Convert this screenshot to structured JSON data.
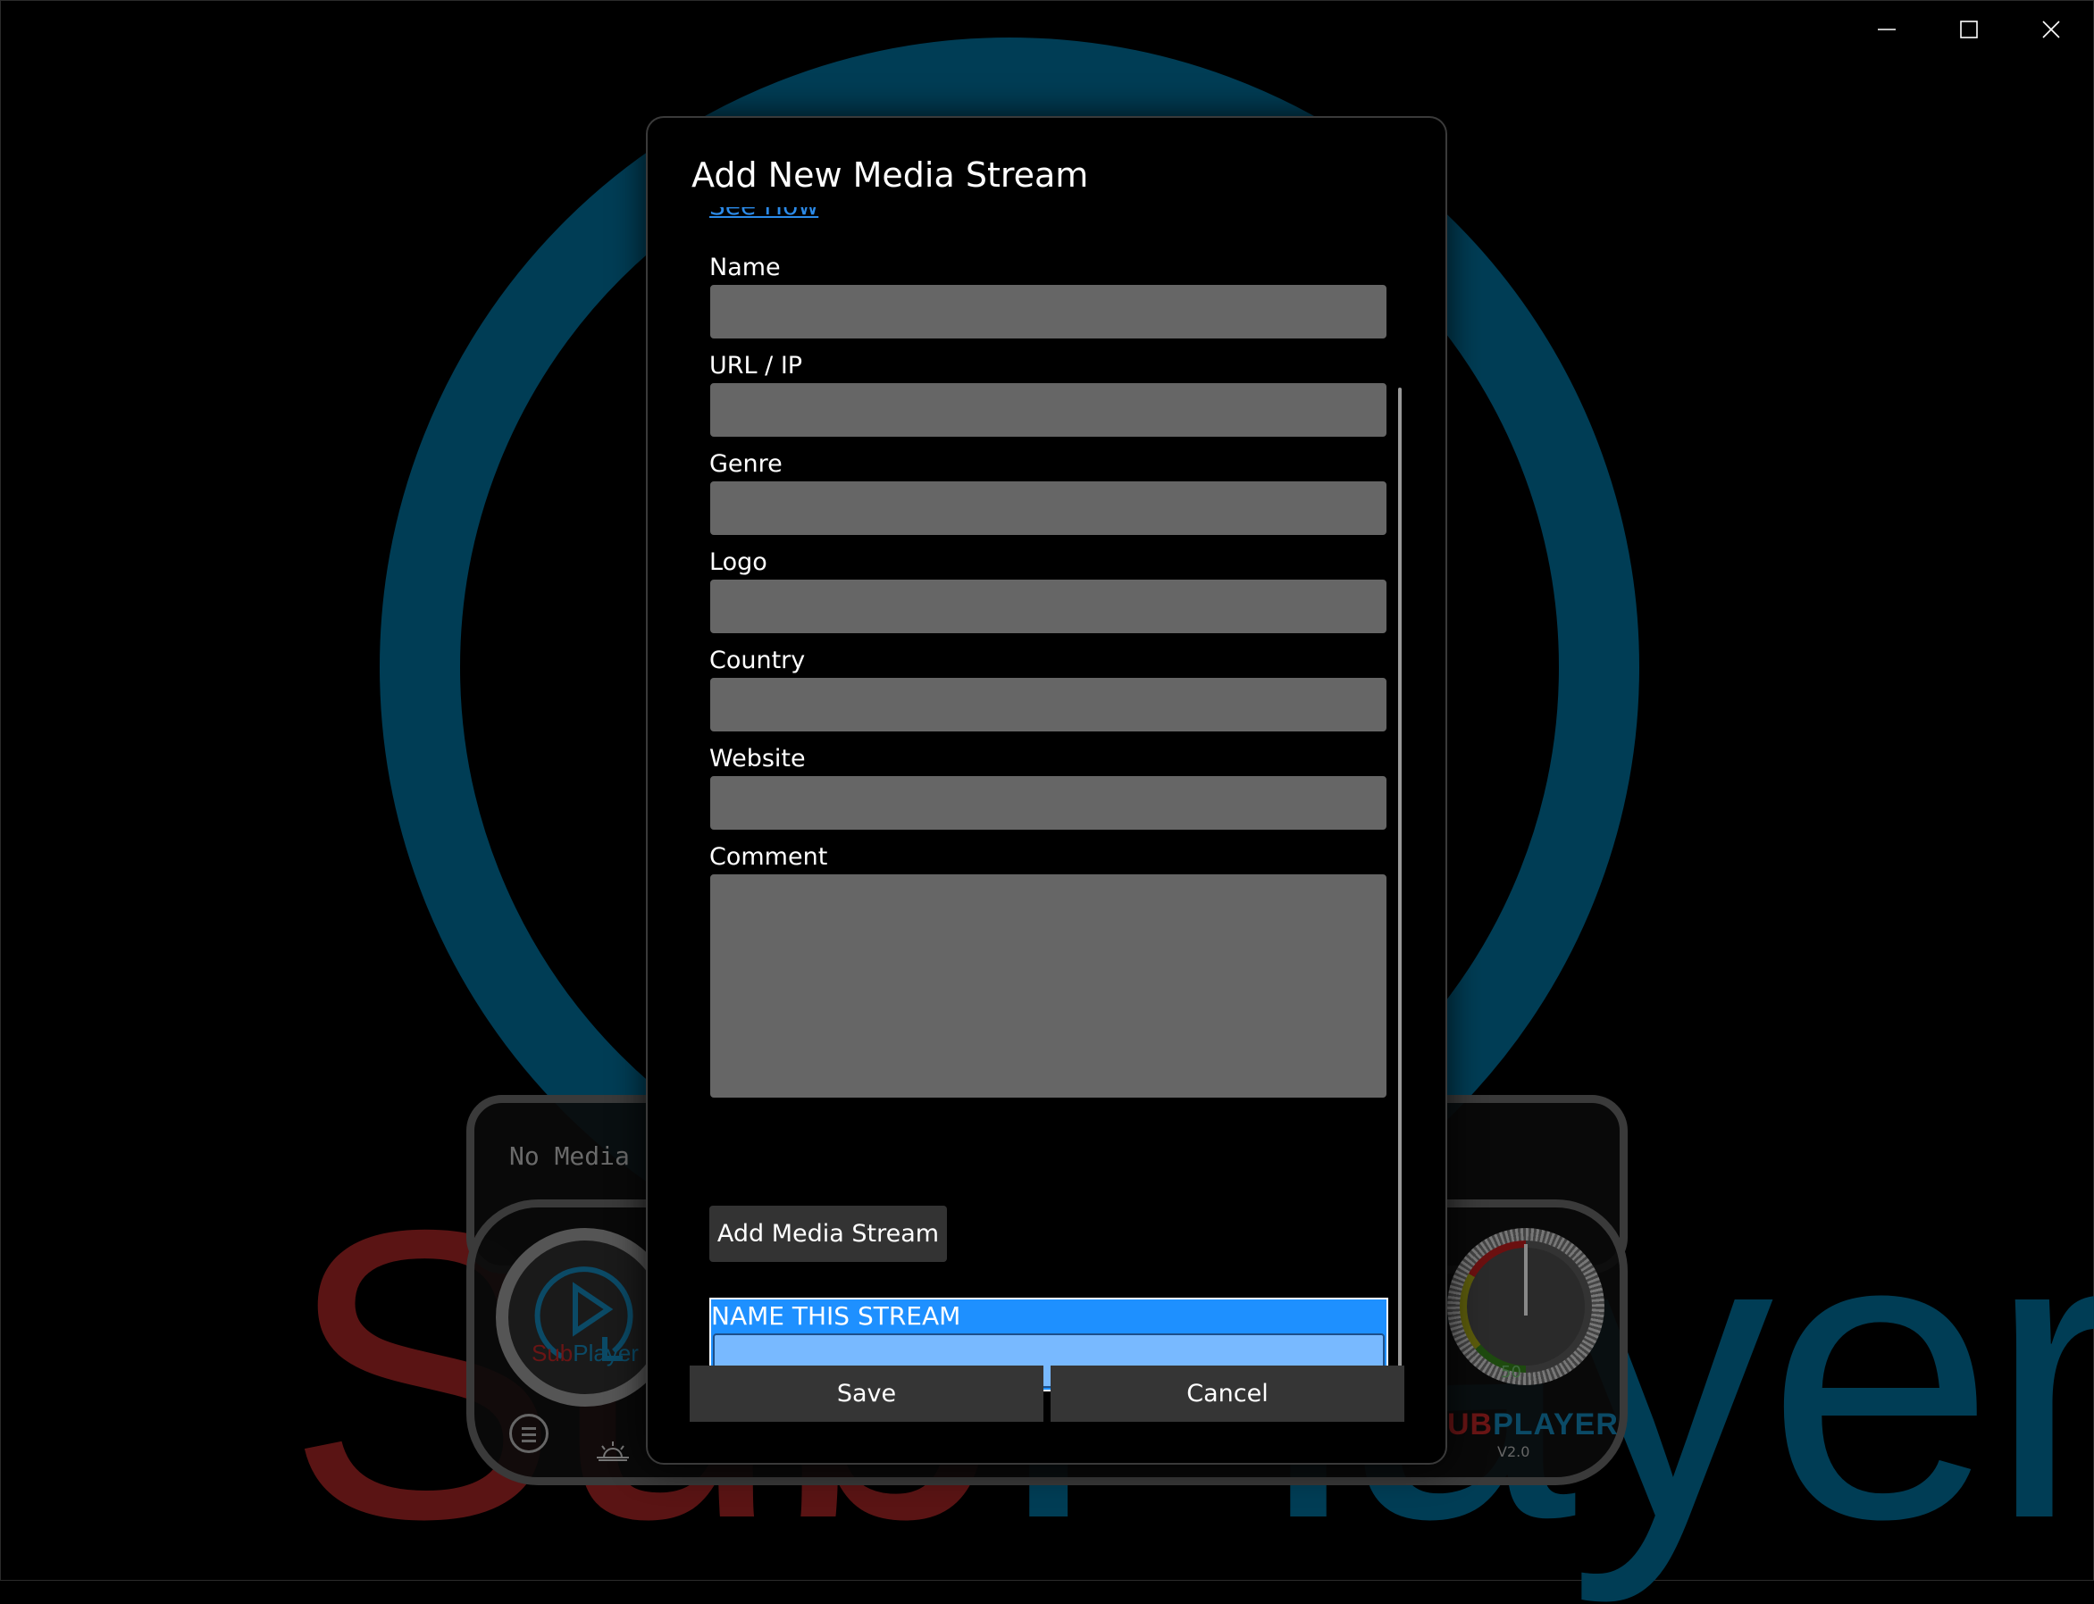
{
  "window": {
    "controls": {
      "minimize": "minimize-icon",
      "maximize": "maximize-icon",
      "close": "close-icon"
    }
  },
  "background": {
    "title_sub": "Sub",
    "title_player": "Player",
    "now_playing": "No Media",
    "left_logo_sub": "Sub",
    "left_logo_player": "Player",
    "right_logo_sub": "UB",
    "right_logo_player": "PLAYER",
    "version": "V2.0",
    "volume_value": "50",
    "colors": {
      "ring": "#003d55",
      "sub_red": "#5a1414",
      "player_blue": "#003d55"
    }
  },
  "dialog": {
    "title": "Add New Media Stream",
    "link_text": "See How",
    "fields": [
      {
        "label": "Name",
        "value": ""
      },
      {
        "label": "URL / IP",
        "value": ""
      },
      {
        "label": "Genre",
        "value": ""
      },
      {
        "label": "Logo",
        "value": ""
      },
      {
        "label": "Country",
        "value": ""
      },
      {
        "label": "Website",
        "value": ""
      },
      {
        "label": "Comment",
        "value": ""
      }
    ],
    "add_button": "Add Media Stream",
    "name_stream": {
      "label": "NAME THIS STREAM",
      "value": ""
    },
    "save_button": "Save",
    "cancel_button": "Cancel",
    "colors": {
      "accent": "#1e90ff",
      "input_highlight": "#78b9ff",
      "field_bg": "#666666",
      "button_bg": "#353535",
      "link": "#2b8ae8"
    }
  }
}
